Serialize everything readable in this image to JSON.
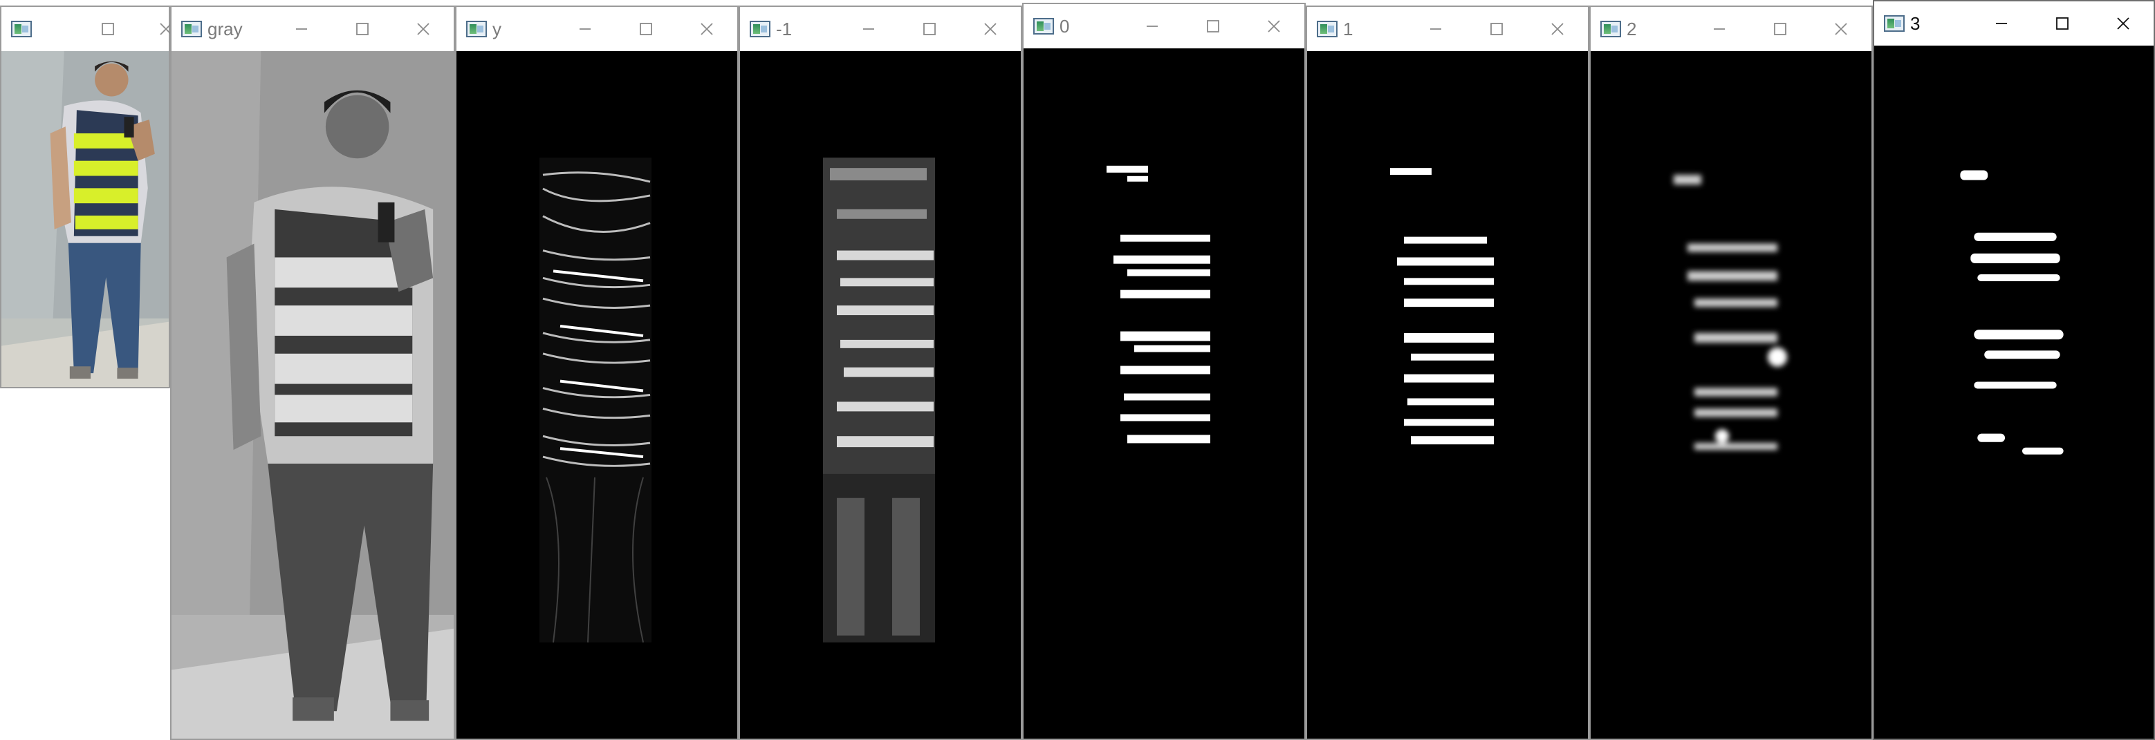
{
  "windows": [
    {
      "id": "original",
      "title": "",
      "kind": "color-photo"
    },
    {
      "id": "gray",
      "title": "gray",
      "kind": "gray-photo"
    },
    {
      "id": "y",
      "title": "y",
      "kind": "edge-map"
    },
    {
      "id": "m1",
      "title": "-1",
      "kind": "gradient-map"
    },
    {
      "id": "s0",
      "title": "0",
      "kind": "binary-mask"
    },
    {
      "id": "s1",
      "title": "1",
      "kind": "binary-mask"
    },
    {
      "id": "s2",
      "title": "2",
      "kind": "blurred-mask"
    },
    {
      "id": "s3",
      "title": "3",
      "kind": "binary-mask"
    }
  ],
  "controls": {
    "minimize_icon": "minimize-icon",
    "maximize_icon": "maximize-icon",
    "close_icon": "close-icon"
  },
  "colors": {
    "vest_yellow": "#d8ef2a",
    "vest_navy": "#2c3a55",
    "mask_white": "#ffffff",
    "background_black": "#000000"
  }
}
